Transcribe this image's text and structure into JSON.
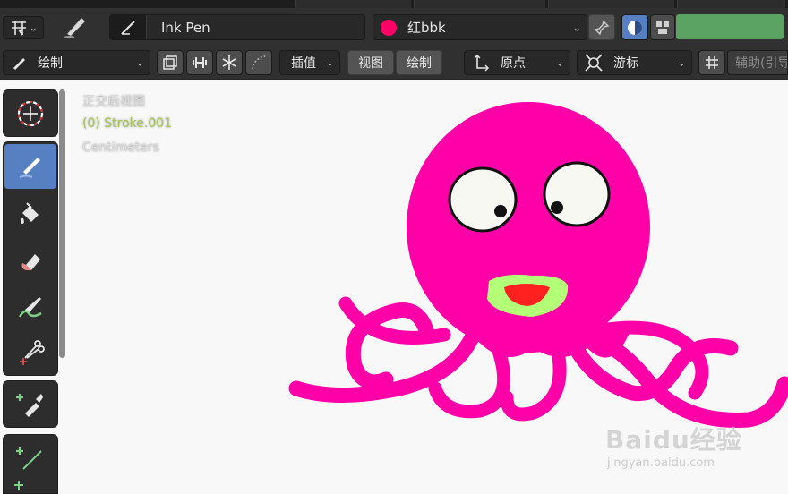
{
  "header": {
    "brush_name": "Ink Pen",
    "material_name": "红bbk",
    "material_color": "#ff0066"
  },
  "toolbar_row": {
    "mode_label": "绘制",
    "interpolate_label": "插值",
    "view_label": "视图",
    "draw_label": "绘制",
    "origin_label": "原点",
    "cursor_label": "游标",
    "guides_label": "辅助(引导"
  },
  "viewport": {
    "view_name": "正交后视图",
    "object_name": "(0) Stroke.001",
    "units": "Centimeters",
    "background": "#f8f8f8"
  },
  "tools": [
    {
      "name": "cursor-tool",
      "icon": "crosshair-cursor-icon"
    },
    {
      "name": "draw-tool",
      "icon": "pencil-icon",
      "active": true
    },
    {
      "name": "fill-tool",
      "icon": "paint-bucket-icon"
    },
    {
      "name": "erase-tool",
      "icon": "eraser-icon"
    },
    {
      "name": "tint-tool",
      "icon": "brush-icon"
    },
    {
      "name": "cutter-tool",
      "icon": "scissors-icon"
    },
    {
      "name": "eyedropper-tool",
      "icon": "eyedropper-icon"
    },
    {
      "name": "line-tool",
      "icon": "line-icon"
    }
  ],
  "colors": {
    "accent_active": "#5680c2",
    "octopus": "#ff00a8",
    "lips": "#b4ff78",
    "mouth": "#ff2020",
    "green_bar": "#5aa363"
  },
  "watermark": {
    "brand": "Baidu经验",
    "url": "jingyan.baidu.com"
  }
}
